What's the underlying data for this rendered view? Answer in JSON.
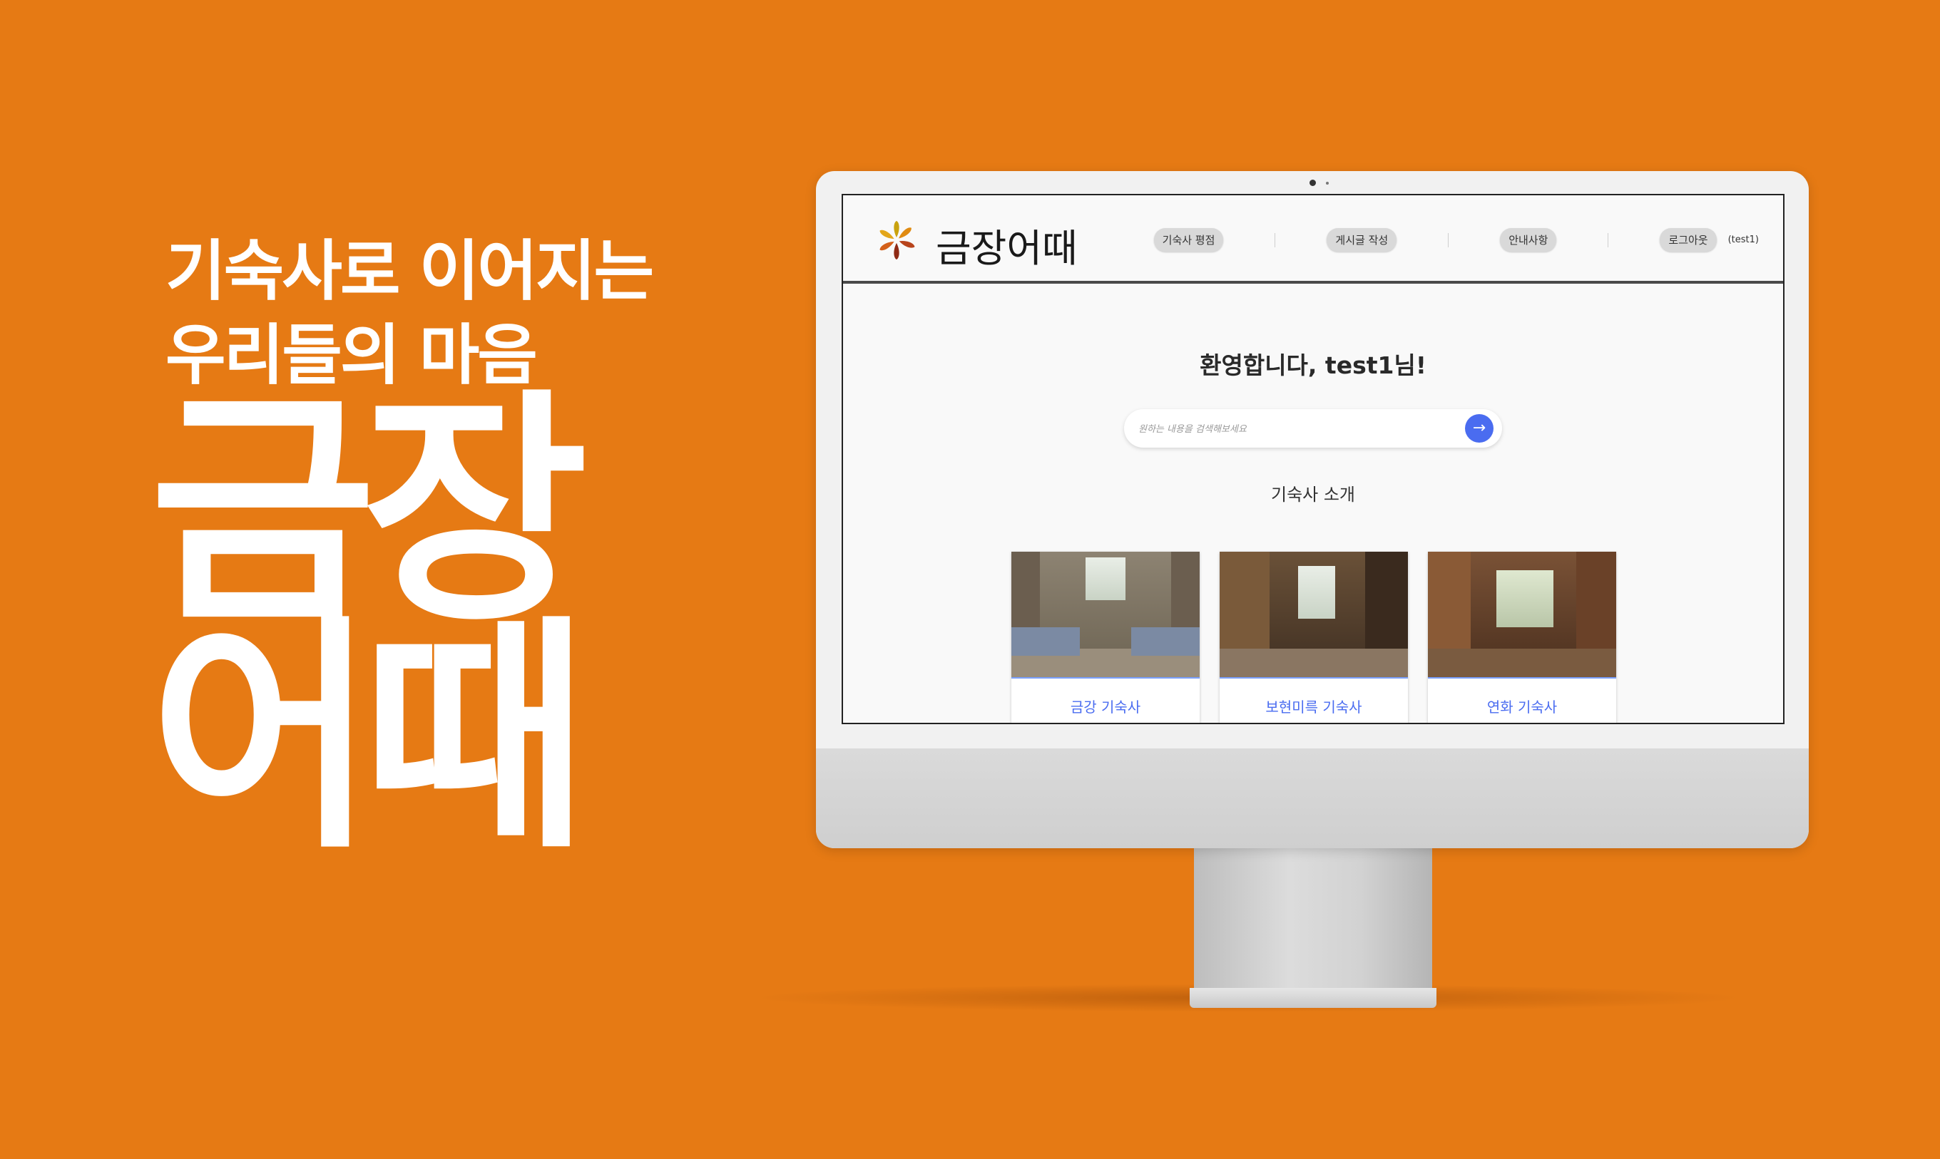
{
  "promo": {
    "line1": "기숙사로 이어지는",
    "line2": "우리들의 마음",
    "title_line1": "금장",
    "title_line2": "어때"
  },
  "site": {
    "logo_text": "금장어때",
    "nav": {
      "review": "기숙사 평점",
      "write": "게시글 작성",
      "notice": "안내사항",
      "logout": "로그아웃",
      "user_id": "(test1)"
    },
    "welcome": "환영합니다, test1님!",
    "search": {
      "placeholder": "원하는 내용을 검색해보세요",
      "button_icon": "arrow-right-icon"
    },
    "section_title": "기숙사 소개",
    "cards": [
      {
        "label": "금강 기숙사"
      },
      {
        "label": "보현미륵 기숙사"
      },
      {
        "label": "연화 기숙사"
      }
    ]
  },
  "colors": {
    "background": "#E67A14",
    "accent": "#4A6CF0"
  }
}
